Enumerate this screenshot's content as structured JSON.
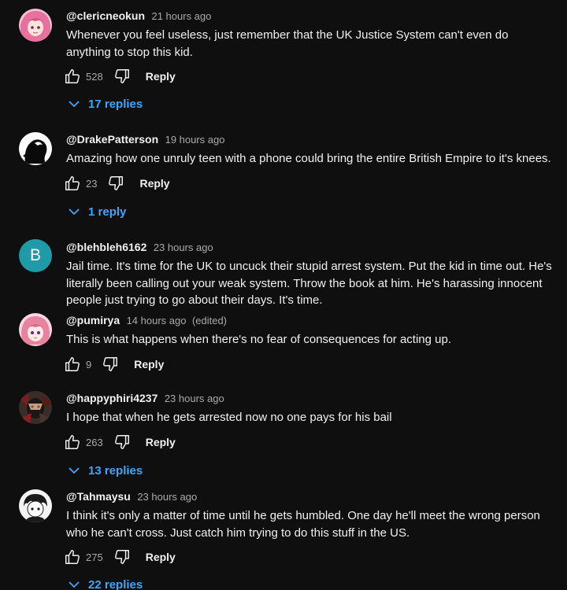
{
  "comments": [
    {
      "author": "@clericneokun",
      "time": "21 hours ago",
      "text": "Whenever you feel useless, just remember that the UK Justice System can't even do anything to stop this kid.",
      "likes": "528",
      "reply_label": "Reply",
      "replies_label": "17 replies",
      "avatar": "anime-pink-hair-avatar"
    },
    {
      "author": "@DrakePatterson",
      "time": "19 hours ago",
      "text": "Amazing how one unruly teen with a phone could bring the entire British Empire to it's knees.",
      "likes": "23",
      "reply_label": "Reply",
      "replies_label": "1 reply",
      "avatar": "silhouette-avatar"
    },
    {
      "author": "@blehbleh6162",
      "time": "23 hours ago",
      "text": "Jail time. It's time for the UK to uncuck their stupid arrest system. Put the kid in time out. He's literally been calling out your weak system. Throw the book at him. He's harassing innocent people just trying to go about their days. It's time.",
      "avatar_letter": "B",
      "avatar_color": "#1f9aa7"
    },
    {
      "author": "@pumirya",
      "time": "14 hours ago",
      "edited": "(edited)",
      "text": "This is what happens when there's no fear of consequences for acting up.",
      "likes": "9",
      "reply_label": "Reply",
      "avatar": "anime-pink-girl-avatar"
    },
    {
      "author": "@happyphiri4237",
      "time": "23 hours ago",
      "text": "I hope that when he gets arrested now no one pays for his bail",
      "likes": "263",
      "reply_label": "Reply",
      "replies_label": "13 replies",
      "avatar": "dark-character-avatar"
    },
    {
      "author": "@Tahmaysu",
      "time": "23 hours ago",
      "text": "I think it's only a matter of time until he gets humbled. One day he'll meet the wrong person who he can't cross. Just catch him trying to do this stuff in the US.",
      "likes": "275",
      "reply_label": "Reply",
      "replies_label": "22 replies",
      "avatar": "manga-boy-avatar"
    }
  ],
  "colors": {
    "background": "#0f0f0f",
    "text": "#f1f1f1",
    "secondary_text": "#aaaaaa",
    "link_blue": "#3ea6ff"
  },
  "icons": {
    "like": "thumbs-up-icon",
    "dislike": "thumbs-down-icon",
    "expand": "chevron-down-icon"
  }
}
